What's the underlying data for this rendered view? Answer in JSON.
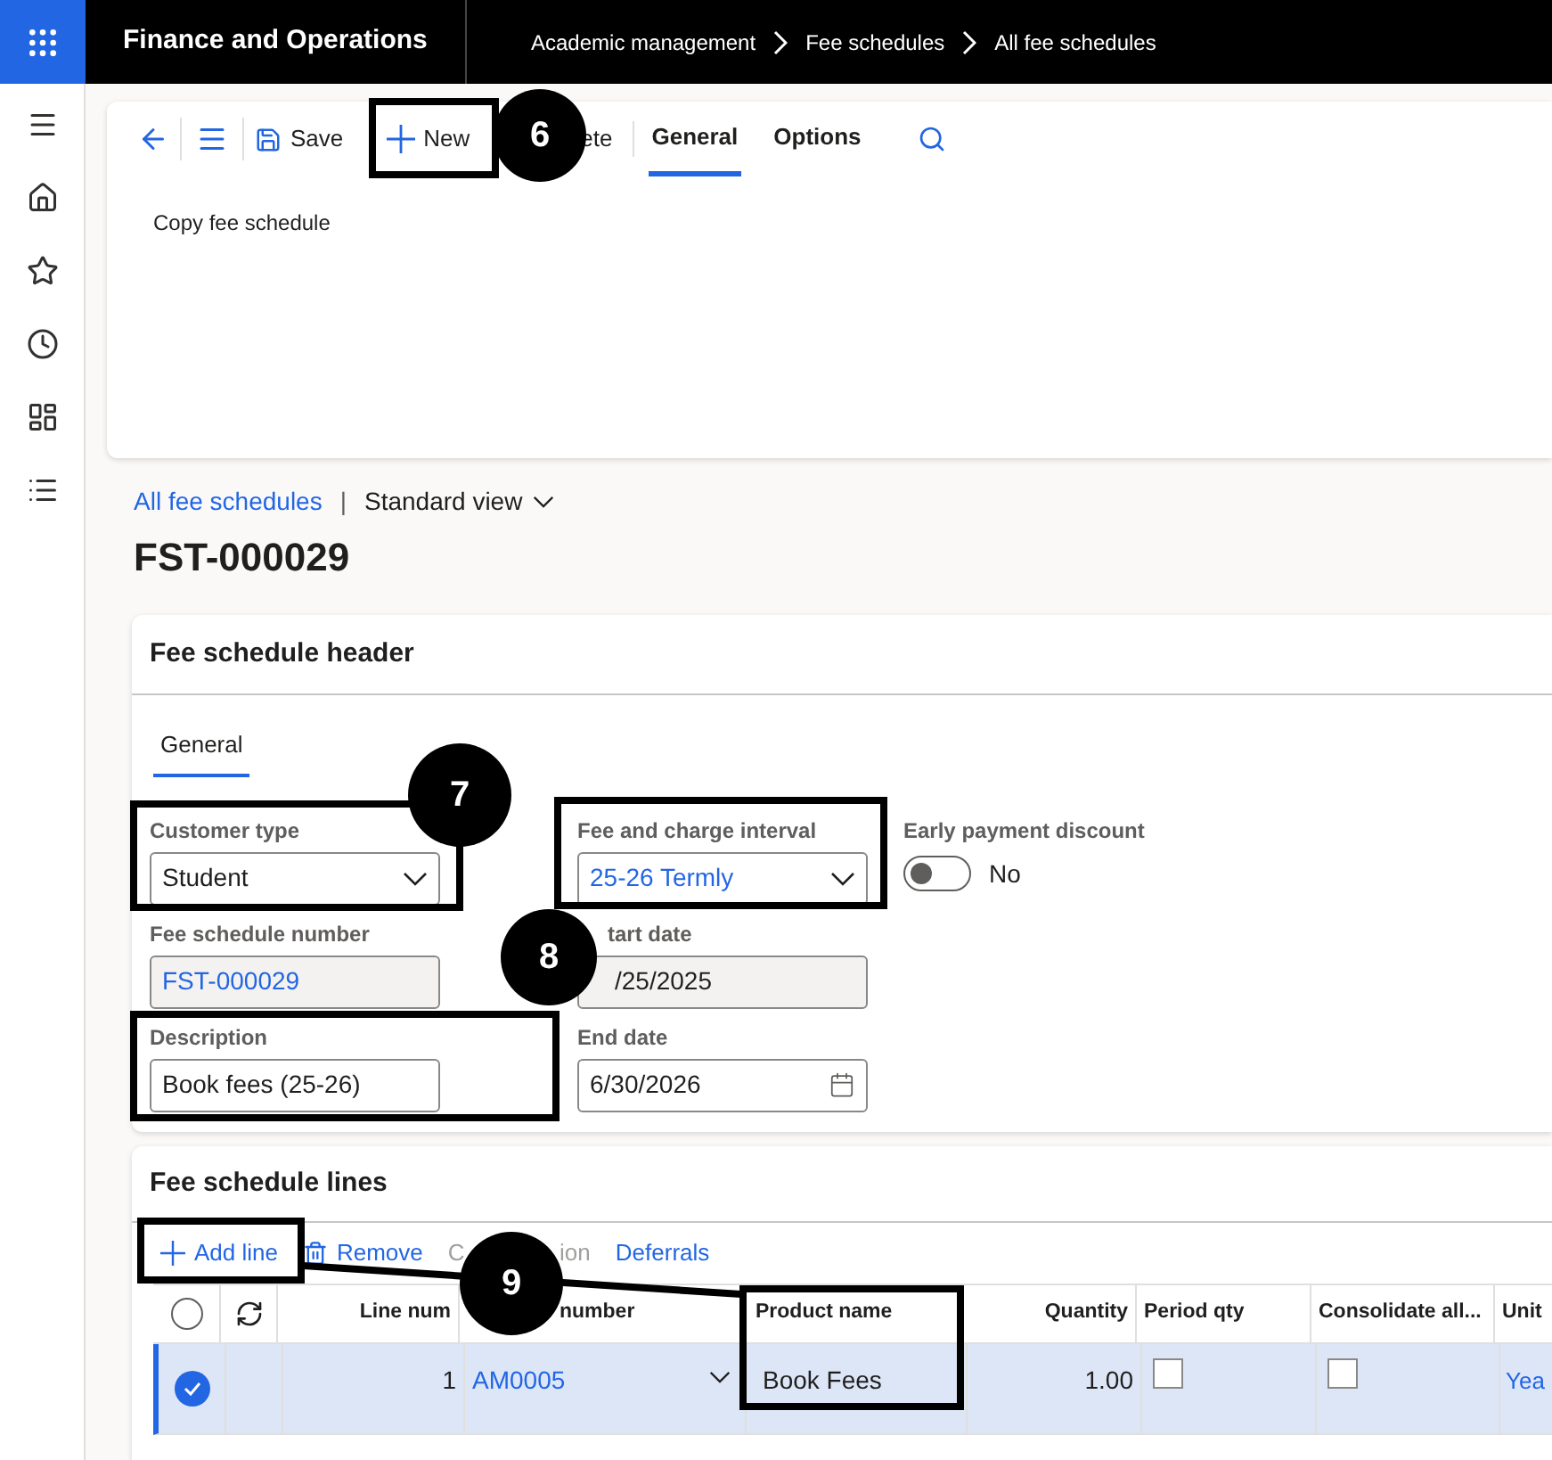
{
  "top_bar": {
    "app_name": "Finance and Operations",
    "breadcrumb": [
      "Academic management",
      "Fee schedules",
      "All fee schedules"
    ]
  },
  "action_pane": {
    "buttons": [
      {
        "kind": "back"
      },
      {
        "kind": "menu"
      },
      {
        "kind": "save",
        "label": "Save"
      },
      {
        "kind": "new",
        "label": "New"
      },
      {
        "kind": "text",
        "label": "ete"
      }
    ],
    "tabs": [
      {
        "label": "General",
        "selected": true
      },
      {
        "label": "Options",
        "selected": false
      }
    ],
    "actions": [
      "Copy fee schedule"
    ]
  },
  "view": {
    "link": "All fee schedules",
    "separator": "|",
    "view_name": "Standard view"
  },
  "record_title": "FST-000029",
  "header": {
    "title": "Fee schedule header",
    "tabs": [
      {
        "label": "General",
        "selected": true
      }
    ],
    "customer_type": {
      "label": "Customer type",
      "value": "Student"
    },
    "fee_interval": {
      "label": "Fee and charge interval",
      "value": "25-26 Termly"
    },
    "early_discount": {
      "label": "Early payment discount",
      "on": false,
      "value": "No"
    },
    "fee_schedule_number": {
      "label": "Fee schedule number",
      "value": "FST-000029"
    },
    "start_date": {
      "label": "tart date",
      "value": "/25/2025"
    },
    "description": {
      "label": "Description",
      "value": "Book fees (25-26)"
    },
    "end_date": {
      "label": "End date",
      "value": "6/30/2026"
    }
  },
  "lines": {
    "title": "Fee schedule lines",
    "toolbar": [
      {
        "kind": "add",
        "label": "Add line",
        "disabled": false
      },
      {
        "kind": "remove",
        "label": "Remove",
        "disabled": false
      },
      {
        "kind": "split",
        "parts": [
          "C",
          "ion"
        ],
        "disabled": true
      },
      {
        "kind": "text",
        "label": "Deferrals",
        "disabled": false
      }
    ],
    "all_selected": false,
    "columns": [
      "Line num",
      "number",
      "Product name",
      "Quantity",
      "Period qty",
      "Consolidate all...",
      "Unit"
    ],
    "rows": [
      {
        "selected": true,
        "line_num": "1",
        "item": "AM0005",
        "product": "Book Fees",
        "quantity": "1.00",
        "period_qty": false,
        "consolidate": false,
        "unit": "Yea"
      }
    ]
  },
  "callouts": [
    {
      "number": "6"
    },
    {
      "number": "7"
    },
    {
      "number": "8"
    },
    {
      "number": "9"
    }
  ]
}
